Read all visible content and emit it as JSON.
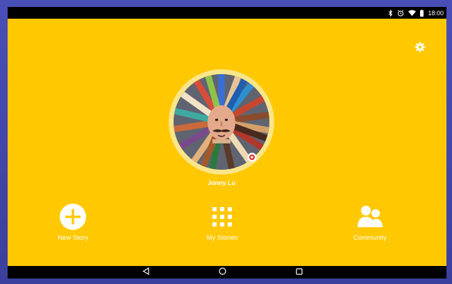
{
  "status_bar": {
    "time": "18:00",
    "icons": [
      "bluetooth-icon",
      "alarm-icon",
      "wifi-icon",
      "battery-icon"
    ]
  },
  "colors": {
    "background": "#ffc800",
    "avatar_ring": "#fbe58a",
    "text": "#ffffff"
  },
  "profile": {
    "name": "Jonny Lu"
  },
  "settings": {
    "icon": "gear-icon"
  },
  "nav": {
    "new_story": {
      "label": "New Story",
      "icon": "plus-circle-icon"
    },
    "my_stories": {
      "label": "My Stories",
      "icon": "grid-icon"
    },
    "community": {
      "label": "Community",
      "icon": "people-icon"
    }
  },
  "system_nav": {
    "back": "back-triangle-icon",
    "home": "home-circle-icon",
    "recents": "recents-square-icon"
  }
}
